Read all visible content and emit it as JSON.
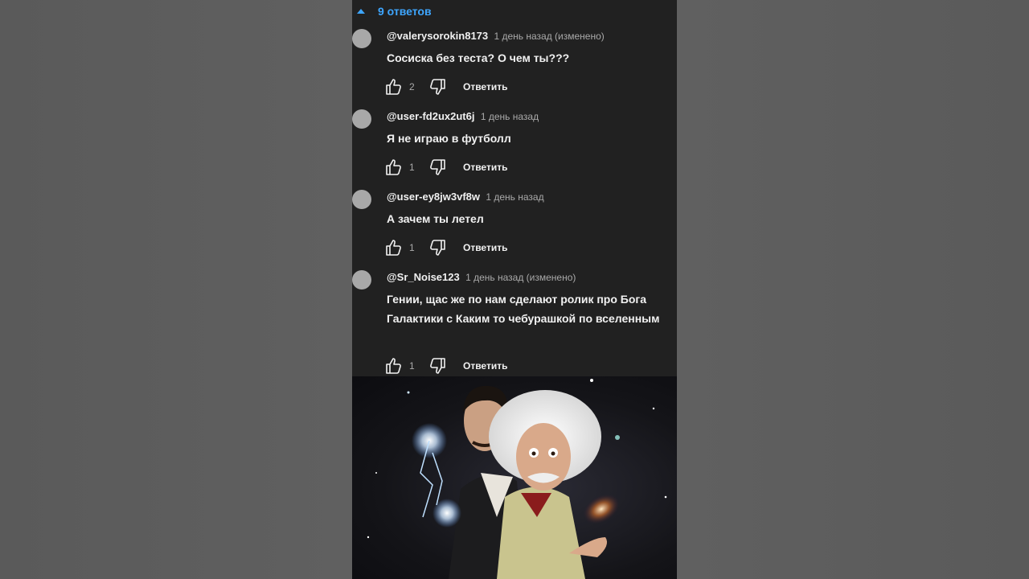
{
  "replies_toggle": {
    "label": "9 ответов",
    "icon": "caret-up-icon",
    "color": "#3ea6ff"
  },
  "comments": [
    {
      "author": "@valerysorokin8173",
      "time": "1 день назад (изменено)",
      "text": "Сосиска без теста? О чем ты???",
      "likes": "2",
      "reply": "Ответить"
    },
    {
      "author": "@user-fd2ux2ut6j",
      "time": "1 день назад",
      "text": "Я не играю в футболл",
      "likes": "1",
      "reply": "Ответить"
    },
    {
      "author": "@user-ey8jw3vf8w",
      "time": "1 день назад",
      "text": "А зачем ты летел",
      "likes": "1",
      "reply": "Ответить"
    },
    {
      "author": "@Sr_Noise123",
      "time": "1 день назад (изменено)",
      "text": "Гении, щас же по нам сделают ролик про Бога Галактики с Каким то чебурашкой по вселенным",
      "likes": "1",
      "reply": "Ответить"
    }
  ],
  "image": {
    "icon": "tesla-einstein-caricature-image"
  },
  "colors": {
    "background": "#212121",
    "text": "#f1f1f1",
    "secondary": "#aaaaaa"
  }
}
